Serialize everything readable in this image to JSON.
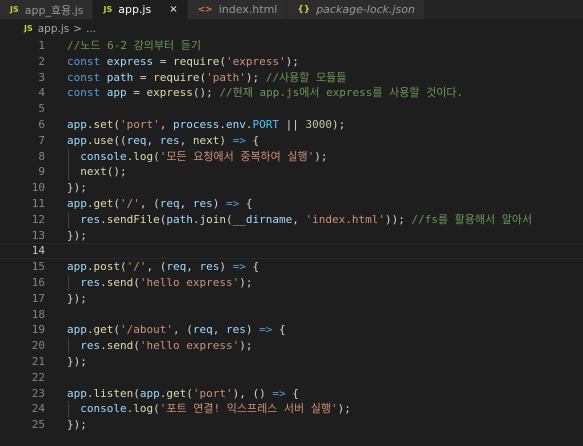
{
  "tabs": [
    {
      "icon": "JS",
      "name": "app_효용.js",
      "active": false,
      "italic": false
    },
    {
      "icon": "JS",
      "name": "app.js",
      "active": true,
      "italic": false,
      "close": "×"
    },
    {
      "icon": "<>",
      "name": "index.html",
      "active": false,
      "italic": false
    },
    {
      "icon": "{}",
      "name": "package-lock.json",
      "active": false,
      "italic": true
    }
  ],
  "breadcrumb": {
    "icon": "JS",
    "file": "app.js",
    "sep": ">",
    "rest": "..."
  },
  "current_line": 14,
  "lines": [
    {
      "n": "1",
      "t": [
        [
          "c",
          "//노드 6-2 강의부터 듣기"
        ]
      ]
    },
    {
      "n": "2",
      "t": [
        [
          "k",
          "const "
        ],
        [
          "v",
          "express"
        ],
        [
          "o",
          " = "
        ],
        [
          "f",
          "require"
        ],
        [
          "o",
          "("
        ],
        [
          "s",
          "'express'"
        ],
        [
          "o",
          ");"
        ]
      ]
    },
    {
      "n": "3",
      "t": [
        [
          "k",
          "const "
        ],
        [
          "v",
          "path"
        ],
        [
          "o",
          " = "
        ],
        [
          "f",
          "require"
        ],
        [
          "o",
          "("
        ],
        [
          "s",
          "'path'"
        ],
        [
          "o",
          "); "
        ],
        [
          "c",
          "//사용할 모듈들"
        ]
      ]
    },
    {
      "n": "4",
      "t": [
        [
          "k",
          "const "
        ],
        [
          "v",
          "app"
        ],
        [
          "o",
          " = "
        ],
        [
          "f",
          "express"
        ],
        [
          "o",
          "(); "
        ],
        [
          "c",
          "//현재 app.js에서 express를 사용할 것이다."
        ]
      ]
    },
    {
      "n": "5",
      "t": []
    },
    {
      "n": "6",
      "t": [
        [
          "v",
          "app"
        ],
        [
          "o",
          "."
        ],
        [
          "f",
          "set"
        ],
        [
          "o",
          "("
        ],
        [
          "s",
          "'port'"
        ],
        [
          "o",
          ", "
        ],
        [
          "v",
          "process"
        ],
        [
          "o",
          "."
        ],
        [
          "v",
          "env"
        ],
        [
          "o",
          "."
        ],
        [
          "cv",
          "PORT"
        ],
        [
          "o",
          " || "
        ],
        [
          "n",
          "3000"
        ],
        [
          "o",
          ");"
        ]
      ]
    },
    {
      "n": "7",
      "t": [
        [
          "v",
          "app"
        ],
        [
          "o",
          "."
        ],
        [
          "f",
          "use"
        ],
        [
          "o",
          "(("
        ],
        [
          "v",
          "req"
        ],
        [
          "o",
          ", "
        ],
        [
          "v",
          "res"
        ],
        [
          "o",
          ", "
        ],
        [
          "f",
          "next"
        ],
        [
          "o",
          ") "
        ],
        [
          "k",
          "=>"
        ],
        [
          "o",
          " {"
        ]
      ]
    },
    {
      "n": "8",
      "t": [
        [
          "o",
          "  "
        ],
        [
          "v",
          "console"
        ],
        [
          "o",
          "."
        ],
        [
          "f",
          "log"
        ],
        [
          "o",
          "("
        ],
        [
          "s",
          "'모든 요청에서 중복하여 실행'"
        ],
        [
          "o",
          ");"
        ]
      ]
    },
    {
      "n": "9",
      "t": [
        [
          "o",
          "  "
        ],
        [
          "f",
          "next"
        ],
        [
          "o",
          "();"
        ]
      ]
    },
    {
      "n": "10",
      "t": [
        [
          "o",
          "});"
        ]
      ]
    },
    {
      "n": "11",
      "t": [
        [
          "v",
          "app"
        ],
        [
          "o",
          "."
        ],
        [
          "f",
          "get"
        ],
        [
          "o",
          "("
        ],
        [
          "s",
          "'/'"
        ],
        [
          "o",
          ", ("
        ],
        [
          "v",
          "req"
        ],
        [
          "o",
          ", "
        ],
        [
          "v",
          "res"
        ],
        [
          "o",
          ") "
        ],
        [
          "k",
          "=>"
        ],
        [
          "o",
          " {"
        ]
      ]
    },
    {
      "n": "12",
      "t": [
        [
          "o",
          "  "
        ],
        [
          "v",
          "res"
        ],
        [
          "o",
          "."
        ],
        [
          "f",
          "sendFile"
        ],
        [
          "o",
          "("
        ],
        [
          "v",
          "path"
        ],
        [
          "o",
          "."
        ],
        [
          "f",
          "join"
        ],
        [
          "o",
          "("
        ],
        [
          "v",
          "__dirname"
        ],
        [
          "o",
          ", "
        ],
        [
          "s",
          "'index.html'"
        ],
        [
          "o",
          "));"
        ],
        [
          "c",
          " //fs를 활용해서 알아서"
        ]
      ]
    },
    {
      "n": "13",
      "t": [
        [
          "o",
          "});"
        ]
      ]
    },
    {
      "n": "14",
      "t": []
    },
    {
      "n": "15",
      "t": [
        [
          "v",
          "app"
        ],
        [
          "o",
          "."
        ],
        [
          "f",
          "post"
        ],
        [
          "o",
          "("
        ],
        [
          "s",
          "'/'"
        ],
        [
          "o",
          ", ("
        ],
        [
          "v",
          "req"
        ],
        [
          "o",
          ", "
        ],
        [
          "v",
          "res"
        ],
        [
          "o",
          ") "
        ],
        [
          "k",
          "=>"
        ],
        [
          "o",
          " {"
        ]
      ]
    },
    {
      "n": "16",
      "t": [
        [
          "o",
          "  "
        ],
        [
          "v",
          "res"
        ],
        [
          "o",
          "."
        ],
        [
          "f",
          "send"
        ],
        [
          "o",
          "("
        ],
        [
          "s",
          "'hello express'"
        ],
        [
          "o",
          ");"
        ]
      ]
    },
    {
      "n": "17",
      "t": [
        [
          "o",
          "});"
        ]
      ]
    },
    {
      "n": "18",
      "t": []
    },
    {
      "n": "19",
      "t": [
        [
          "v",
          "app"
        ],
        [
          "o",
          "."
        ],
        [
          "f",
          "get"
        ],
        [
          "o",
          "("
        ],
        [
          "s",
          "'/about'"
        ],
        [
          "o",
          ", ("
        ],
        [
          "v",
          "req"
        ],
        [
          "o",
          ", "
        ],
        [
          "v",
          "res"
        ],
        [
          "o",
          ") "
        ],
        [
          "k",
          "=>"
        ],
        [
          "o",
          " {"
        ]
      ]
    },
    {
      "n": "20",
      "t": [
        [
          "o",
          "  "
        ],
        [
          "v",
          "res"
        ],
        [
          "o",
          "."
        ],
        [
          "f",
          "send"
        ],
        [
          "o",
          "("
        ],
        [
          "s",
          "'hello express'"
        ],
        [
          "o",
          ");"
        ]
      ]
    },
    {
      "n": "21",
      "t": [
        [
          "o",
          "});"
        ]
      ]
    },
    {
      "n": "22",
      "t": []
    },
    {
      "n": "23",
      "t": [
        [
          "v",
          "app"
        ],
        [
          "o",
          "."
        ],
        [
          "f",
          "listen"
        ],
        [
          "o",
          "("
        ],
        [
          "v",
          "app"
        ],
        [
          "o",
          "."
        ],
        [
          "f",
          "get"
        ],
        [
          "o",
          "("
        ],
        [
          "s",
          "'port'"
        ],
        [
          "o",
          "), () "
        ],
        [
          "k",
          "=>"
        ],
        [
          "o",
          " {"
        ]
      ]
    },
    {
      "n": "24",
      "t": [
        [
          "o",
          "  "
        ],
        [
          "v",
          "console"
        ],
        [
          "o",
          "."
        ],
        [
          "f",
          "log"
        ],
        [
          "o",
          "("
        ],
        [
          "s",
          "'포트 연결! 익스프레스 서버 실행'"
        ],
        [
          "o",
          ");"
        ]
      ]
    },
    {
      "n": "25",
      "t": [
        [
          "o",
          "});"
        ]
      ]
    }
  ]
}
